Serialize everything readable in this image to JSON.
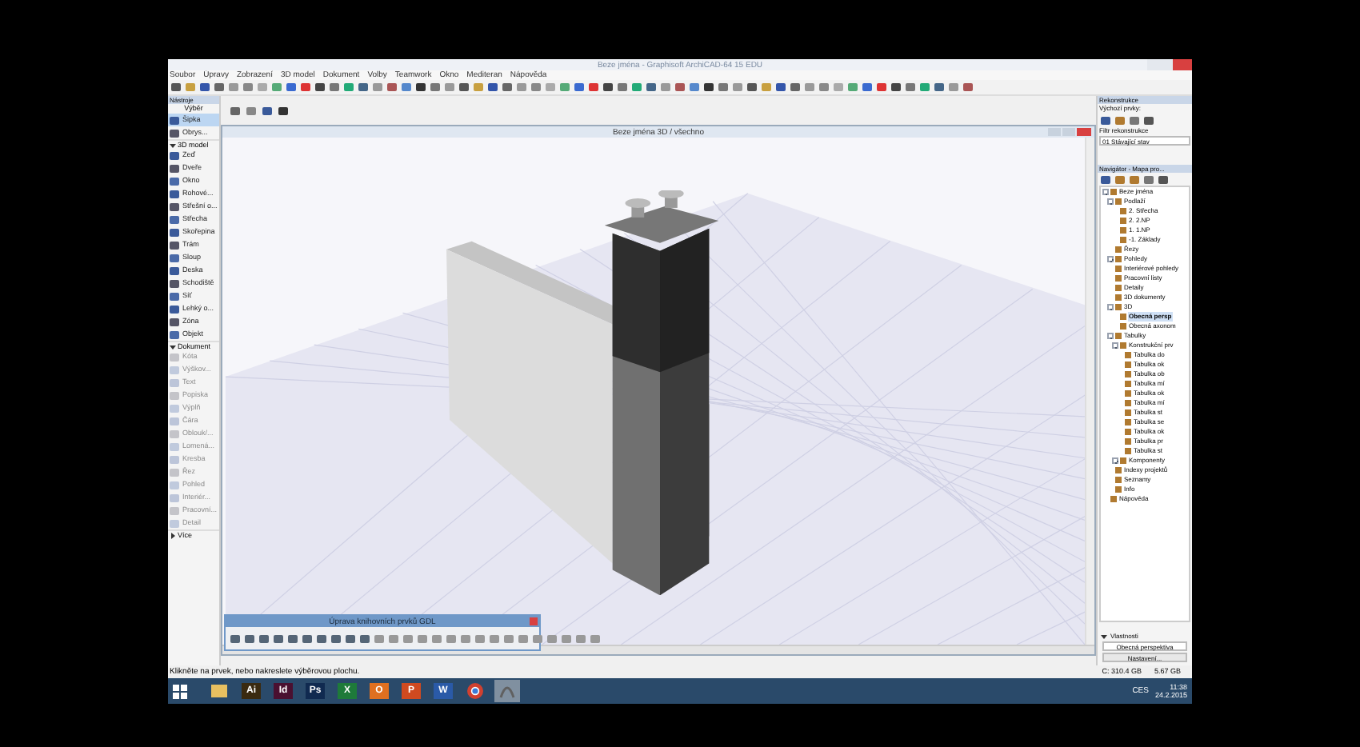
{
  "window": {
    "title": "Beze jména - Graphisoft ArchiCAD-64 15 EDU"
  },
  "menu": [
    "Soubor",
    "Úpravy",
    "Zobrazení",
    "3D model",
    "Dokument",
    "Volby",
    "Teamwork",
    "Okno",
    "Mediteran",
    "Nápověda"
  ],
  "toolbox": {
    "title": "Nástroje",
    "subtitle": "Výběr",
    "items": [
      {
        "kind": "tool",
        "label": "Šipka",
        "selected": true,
        "disabled": false
      },
      {
        "kind": "tool",
        "label": "Obrys...",
        "selected": false,
        "disabled": false
      },
      {
        "kind": "section",
        "label": "3D model",
        "expanded": true
      },
      {
        "kind": "tool",
        "label": "Zeď",
        "selected": false,
        "disabled": false
      },
      {
        "kind": "tool",
        "label": "Dveře",
        "selected": false,
        "disabled": false
      },
      {
        "kind": "tool",
        "label": "Okno",
        "selected": false,
        "disabled": false
      },
      {
        "kind": "tool",
        "label": "Rohové...",
        "selected": false,
        "disabled": false
      },
      {
        "kind": "tool",
        "label": "Střešní o...",
        "selected": false,
        "disabled": false
      },
      {
        "kind": "tool",
        "label": "Střecha",
        "selected": false,
        "disabled": false
      },
      {
        "kind": "tool",
        "label": "Skořepina",
        "selected": false,
        "disabled": false
      },
      {
        "kind": "tool",
        "label": "Trám",
        "selected": false,
        "disabled": false
      },
      {
        "kind": "tool",
        "label": "Sloup",
        "selected": false,
        "disabled": false
      },
      {
        "kind": "tool",
        "label": "Deska",
        "selected": false,
        "disabled": false
      },
      {
        "kind": "tool",
        "label": "Schodiště",
        "selected": false,
        "disabled": false
      },
      {
        "kind": "tool",
        "label": "Síť",
        "selected": false,
        "disabled": false
      },
      {
        "kind": "tool",
        "label": "Lehký o...",
        "selected": false,
        "disabled": false
      },
      {
        "kind": "tool",
        "label": "Zóna",
        "selected": false,
        "disabled": false
      },
      {
        "kind": "tool",
        "label": "Objekt",
        "selected": false,
        "disabled": false
      },
      {
        "kind": "section",
        "label": "Dokument",
        "expanded": true
      },
      {
        "kind": "tool",
        "label": "Kóta",
        "selected": false,
        "disabled": true
      },
      {
        "kind": "tool",
        "label": "Výškov...",
        "selected": false,
        "disabled": true
      },
      {
        "kind": "tool",
        "label": "Text",
        "selected": false,
        "disabled": true
      },
      {
        "kind": "tool",
        "label": "Popiska",
        "selected": false,
        "disabled": true
      },
      {
        "kind": "tool",
        "label": "Výplň",
        "selected": false,
        "disabled": true
      },
      {
        "kind": "tool",
        "label": "Čára",
        "selected": false,
        "disabled": true
      },
      {
        "kind": "tool",
        "label": "Oblouk/...",
        "selected": false,
        "disabled": true
      },
      {
        "kind": "tool",
        "label": "Lomená...",
        "selected": false,
        "disabled": true
      },
      {
        "kind": "tool",
        "label": "Kresba",
        "selected": false,
        "disabled": true
      },
      {
        "kind": "tool",
        "label": "Řez",
        "selected": false,
        "disabled": true
      },
      {
        "kind": "tool",
        "label": "Pohled",
        "selected": false,
        "disabled": true
      },
      {
        "kind": "tool",
        "label": "Interiér...",
        "selected": false,
        "disabled": true
      },
      {
        "kind": "tool",
        "label": "Pracovní...",
        "selected": false,
        "disabled": true
      },
      {
        "kind": "tool",
        "label": "Detail",
        "selected": false,
        "disabled": true
      },
      {
        "kind": "section",
        "label": "Více",
        "expanded": false
      }
    ]
  },
  "view3d": {
    "title": "Beze jména 3D / všechno"
  },
  "gdl_palette": {
    "title": "Úprava knihovních prvků GDL"
  },
  "reconstruction": {
    "title": "Rekonstrukce",
    "defaults_label": "Výchozí prvky:",
    "filter_label": "Filtr rekonstrukce",
    "filter_value": "01 Stávající stav"
  },
  "navigator": {
    "title": "Navigátor - Mapa pro...",
    "tree": [
      {
        "label": "Beze jména",
        "expanded": true,
        "children": [
          {
            "label": "Podlaží",
            "expanded": true,
            "children": [
              {
                "label": "2. Střecha"
              },
              {
                "label": "2. 2.NP"
              },
              {
                "label": "1. 1.NP"
              },
              {
                "label": "-1. Základy"
              }
            ]
          },
          {
            "label": "Řezy"
          },
          {
            "label": "Pohledy",
            "expanded": false
          },
          {
            "label": "Interiérové pohledy"
          },
          {
            "label": "Pracovní listy"
          },
          {
            "label": "Detaily"
          },
          {
            "label": "3D dokumenty"
          },
          {
            "label": "3D",
            "expanded": true,
            "children": [
              {
                "label": "Obecná persp",
                "selected": true
              },
              {
                "label": "Obecná axonom",
                "selected": false
              }
            ]
          },
          {
            "label": "Tabulky",
            "expanded": true,
            "children": [
              {
                "label": "Konstrukční prv",
                "expanded": true,
                "children": [
                  {
                    "label": "Tabulka do"
                  },
                  {
                    "label": "Tabulka ok"
                  },
                  {
                    "label": "Tabulka ob"
                  },
                  {
                    "label": "Tabulka mí"
                  },
                  {
                    "label": "Tabulka ok"
                  },
                  {
                    "label": "Tabulka mí"
                  },
                  {
                    "label": "Tabulka st"
                  },
                  {
                    "label": "Tabulka se"
                  },
                  {
                    "label": "Tabulka ok"
                  },
                  {
                    "label": "Tabulka pr"
                  },
                  {
                    "label": "Tabulka st"
                  }
                ]
              },
              {
                "label": "Komponenty",
                "expanded": false
              }
            ]
          },
          {
            "label": "Indexy projektů"
          },
          {
            "label": "Seznamy"
          },
          {
            "label": "Info"
          }
        ]
      },
      {
        "label": "Nápověda"
      }
    ]
  },
  "properties": {
    "title": "Vlastnosti",
    "view": "Obecná perspektiva",
    "button": "Nastavení..."
  },
  "status_bar": {
    "message": "Klikněte na prvek, nebo nakreslete výběrovou plochu.",
    "disk": "C: 310.4 GB",
    "memory": "5.67 GB"
  },
  "taskbar": {
    "apps": [
      {
        "kind": "folder",
        "color": "#e8c060",
        "active": false
      },
      {
        "kind": "letter",
        "label": "Ai",
        "color": "#3a2a10",
        "active": false
      },
      {
        "kind": "letter",
        "label": "Id",
        "color": "#4a1030",
        "active": false
      },
      {
        "kind": "letter",
        "label": "Ps",
        "color": "#102a50",
        "active": false
      },
      {
        "kind": "letter",
        "label": "X",
        "color": "#1e7a3a",
        "active": false
      },
      {
        "kind": "letter",
        "label": "O",
        "color": "#e07020",
        "active": false
      },
      {
        "kind": "letter",
        "label": "P",
        "color": "#d04a20",
        "active": false
      },
      {
        "kind": "letter",
        "label": "W",
        "color": "#2a5aa8",
        "active": false
      },
      {
        "kind": "chrome",
        "color": "#d04030",
        "active": false
      },
      {
        "kind": "archicad",
        "color": "#606060",
        "active": true
      }
    ],
    "language": "CES",
    "time": "11:38",
    "date": "24.2.2015"
  }
}
